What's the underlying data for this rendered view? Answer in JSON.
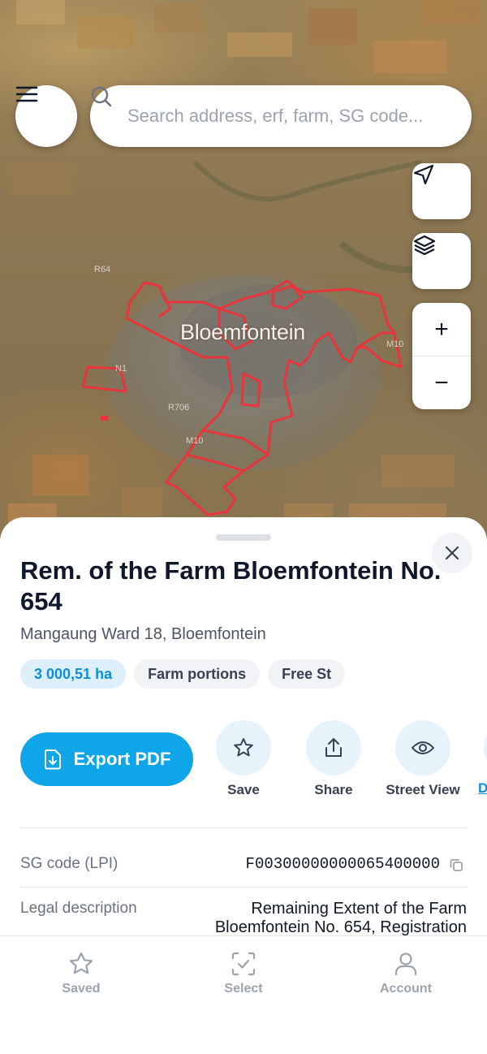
{
  "search": {
    "placeholder": "Search address, erf, farm, SG code..."
  },
  "map": {
    "city_label": "Bloemfontein",
    "road_labels": [
      "R64",
      "N1",
      "R706",
      "M10",
      "M10"
    ],
    "boundary_color": "#e8343a"
  },
  "map_controls": {
    "zoom_in_label": "+",
    "zoom_out_label": "−"
  },
  "sheet": {
    "title": "Rem. of the Farm Bloemfontein No. 654",
    "subtitle": "Mangaung Ward 18, Bloemfontein",
    "chips": [
      "3 000,51 ha",
      "Farm portions",
      "Free St"
    ],
    "export_label": "Export PDF",
    "actions": [
      {
        "label": "Save",
        "icon": "star-icon"
      },
      {
        "label": "Share",
        "icon": "share-icon"
      },
      {
        "label": "Street View",
        "icon": "eye-icon"
      }
    ],
    "more_label": "D",
    "details": [
      {
        "label": "SG code (LPI)",
        "value": "F00300000000065400000"
      },
      {
        "label": "Legal description",
        "value": "Remaining Extent of the Farm Bloemfontein No. 654, Registration"
      }
    ]
  },
  "bottom_nav": {
    "items": [
      {
        "label": "Saved",
        "icon": "star-icon"
      },
      {
        "label": "Select",
        "icon": "select-icon"
      },
      {
        "label": "Account",
        "icon": "account-icon"
      }
    ]
  },
  "colors": {
    "accent": "#0ea5e9",
    "accent_text": "#0e8fd6",
    "boundary": "#e8343a"
  }
}
